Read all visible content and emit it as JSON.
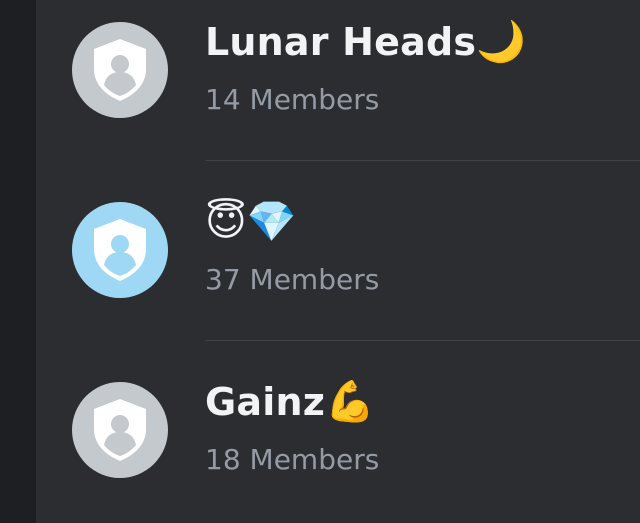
{
  "servers": [
    {
      "name": "Lunar Heads",
      "emoji": "🌙",
      "members": "14 Members",
      "avatar_color": "#c4c9ce",
      "icon": "shield-user-icon"
    },
    {
      "name": "",
      "emoji": "😇💎",
      "members": "37 Members",
      "avatar_color": "#9fd8f5",
      "icon": "shield-user-icon"
    },
    {
      "name": "Gainz",
      "emoji": "💪",
      "members": "18 Members",
      "avatar_color": "#c4c9ce",
      "icon": "shield-user-icon"
    }
  ],
  "colors": {
    "background": "#2b2d31",
    "left_rail": "#1e1f22",
    "name_text": "#f2f3f5",
    "members_text": "#949ba4",
    "divider": "#3f4147"
  }
}
